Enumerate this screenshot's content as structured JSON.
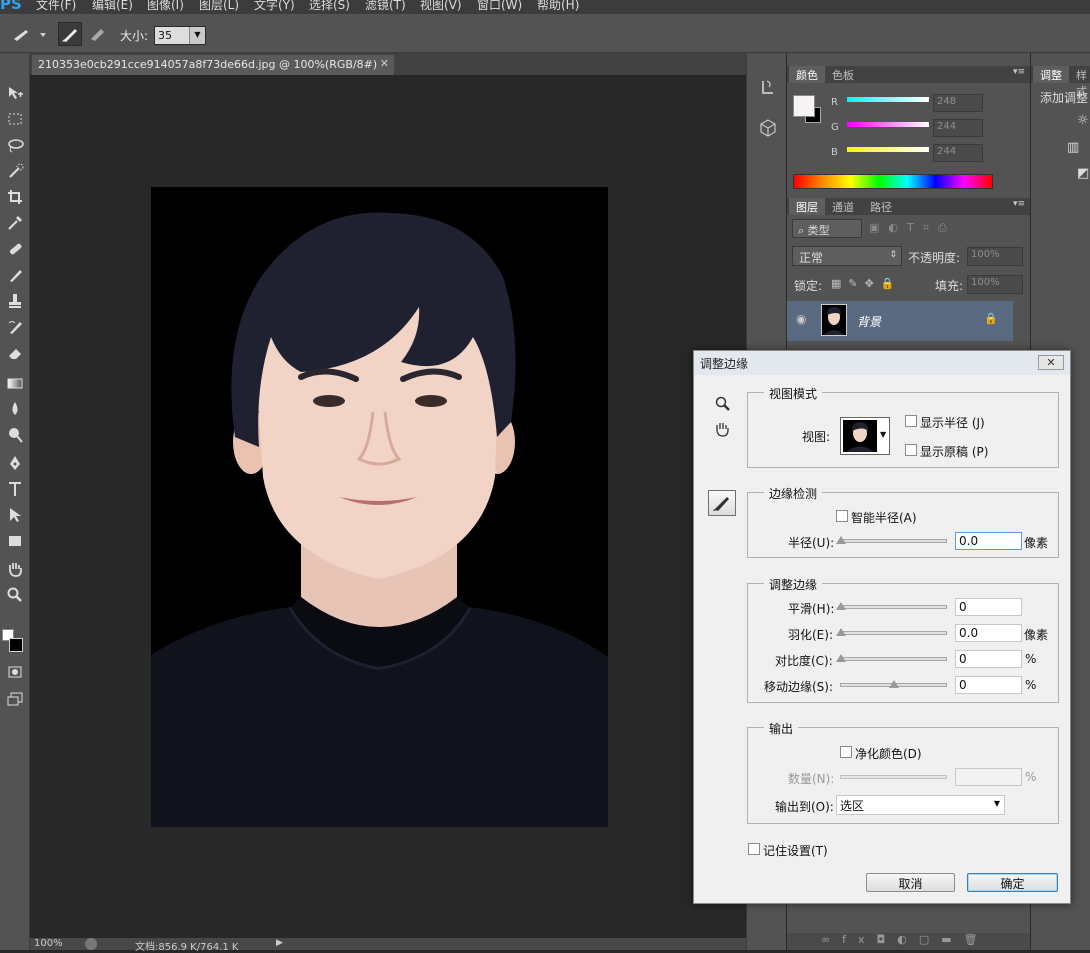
{
  "app": {
    "logo": "PS"
  },
  "menu": [
    "文件(F)",
    "编辑(E)",
    "图像(I)",
    "图层(L)",
    "文字(Y)",
    "选择(S)",
    "滤镜(T)",
    "视图(V)",
    "窗口(W)",
    "帮助(H)"
  ],
  "options_bar": {
    "size_label": "大小:",
    "size_value": "35"
  },
  "document": {
    "tab_title": "210353e0cb291cce914057a8f73de66d.jpg @ 100%(RGB/8#)",
    "zoom": "100%",
    "doc_info": "文档:856.9 K/764.1 K"
  },
  "color_panel": {
    "tabs": [
      "颜色",
      "色板"
    ],
    "r_label": "R",
    "r_value": "248",
    "g_label": "G",
    "g_value": "244",
    "b_label": "B",
    "b_value": "244"
  },
  "adjust_panel": {
    "tabs": [
      "调整",
      "样式"
    ],
    "add_label": "添加调整"
  },
  "layers_panel": {
    "tabs": [
      "图层",
      "通道",
      "路径"
    ],
    "filter_kind": "类型",
    "blend_mode": "正常",
    "opacity_label": "不透明度:",
    "opacity_value": "100%",
    "lock_label": "锁定:",
    "fill_label": "填充:",
    "fill_value": "100%",
    "layer_name": "背景"
  },
  "dialog": {
    "title": "调整边缘",
    "view_mode": {
      "group_title": "视图模式",
      "view_label": "视图:",
      "show_radius": "显示半径 (J)",
      "show_original": "显示原稿 (P)"
    },
    "edge_detection": {
      "group_title": "边缘检测",
      "smart_radius": "智能半径(A)",
      "radius_label": "半径(U):",
      "radius_value": "0.0",
      "radius_unit": "像素"
    },
    "adjust_edge": {
      "group_title": "调整边缘",
      "smooth_label": "平滑(H):",
      "smooth_value": "0",
      "feather_label": "羽化(E):",
      "feather_value": "0.0",
      "feather_unit": "像素",
      "contrast_label": "对比度(C):",
      "contrast_value": "0",
      "contrast_unit": "%",
      "shift_label": "移动边缘(S):",
      "shift_value": "0",
      "shift_unit": "%"
    },
    "output": {
      "group_title": "输出",
      "decontaminate": "净化颜色(D)",
      "amount_label": "数量(N):",
      "amount_unit": "%",
      "output_to_label": "输出到(O):",
      "output_to_value": "选区"
    },
    "remember": "记住设置(T)",
    "cancel": "取消",
    "ok": "确定"
  },
  "colors": {
    "ui_dark": "#535353",
    "canvas_bg": "#282828",
    "photo_bg": "#000000",
    "accent_blue": "#2fa3ef",
    "layer_selected": "#5a6a80"
  }
}
